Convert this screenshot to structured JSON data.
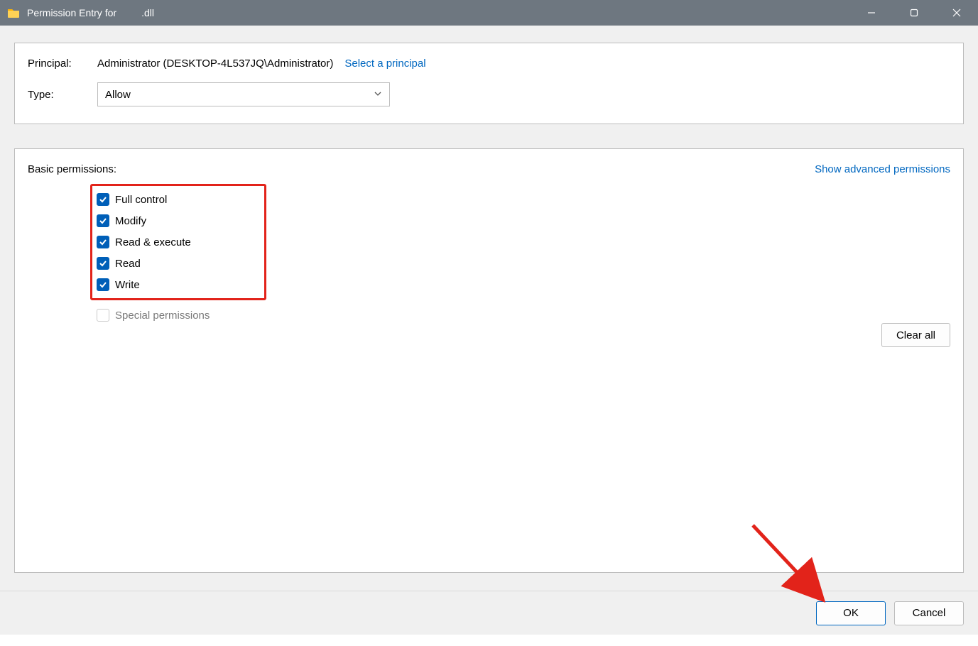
{
  "window": {
    "title_prefix": "Permission Entry for",
    "title_suffix": ".dll"
  },
  "top": {
    "principal_label": "Principal:",
    "principal_value": "Administrator (DESKTOP-4L537JQ\\Administrator)",
    "select_principal": "Select a principal",
    "type_label": "Type:",
    "type_value": "Allow"
  },
  "perms": {
    "header": "Basic permissions:",
    "advanced_link": "Show advanced permissions",
    "items": [
      {
        "label": "Full control",
        "checked": true
      },
      {
        "label": "Modify",
        "checked": true
      },
      {
        "label": "Read & execute",
        "checked": true
      },
      {
        "label": "Read",
        "checked": true
      },
      {
        "label": "Write",
        "checked": true
      }
    ],
    "special_label": "Special permissions",
    "clear_all": "Clear all"
  },
  "footer": {
    "ok": "OK",
    "cancel": "Cancel"
  },
  "colors": {
    "titlebar": "#6e7780",
    "accent": "#005fb8",
    "link": "#0067c0",
    "highlight_box": "#e2231a"
  }
}
